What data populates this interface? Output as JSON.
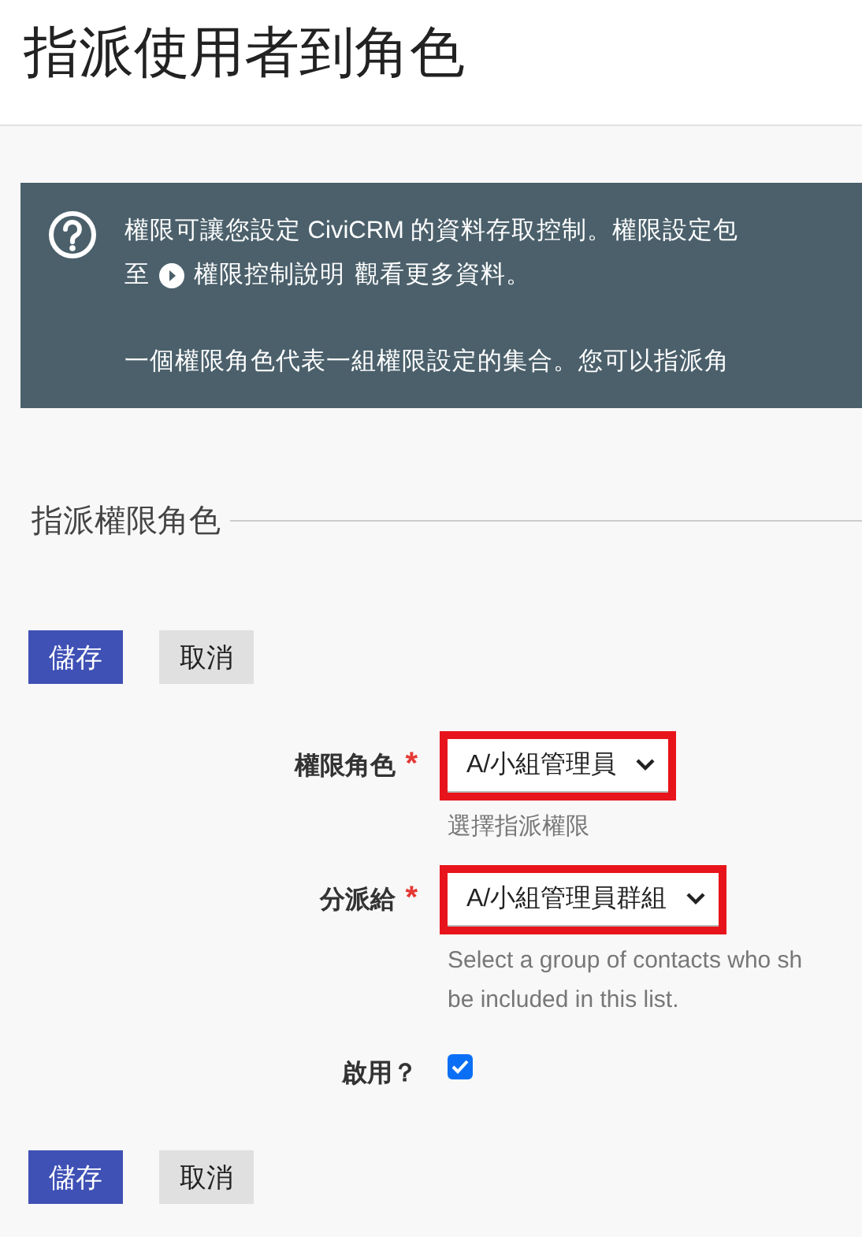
{
  "page_title": "指派使用者到角色",
  "help": {
    "line_1": "權限可讓您設定 CiviCRM 的資料存取控制。權限設定包",
    "line_2_before": "至",
    "link": "權限控制說明",
    "line_2_after": "觀看更多資料。",
    "line_3": "一個權限角色代表一組權限設定的集合。您可以指派角"
  },
  "fieldset": {
    "legend": "指派權限角色"
  },
  "top_buttons": [
    {
      "label": "儲存",
      "kind": "primary"
    },
    {
      "label": "取消",
      "kind": "secondary"
    }
  ],
  "fields": [
    {
      "kind": "select",
      "label": "權限角色",
      "required_mark": "*",
      "value": "A/小組管理員",
      "highlighted": true,
      "help_lines": [
        "選擇指派權限"
      ]
    },
    {
      "kind": "select",
      "label": "分派給",
      "required_mark": "*",
      "value": "A/小組管理員群組",
      "highlighted": true,
      "help_lines": [
        "Select a group of contacts who sh",
        "be included in this list."
      ]
    },
    {
      "kind": "checkbox",
      "label": "啟用？",
      "checked": true
    }
  ],
  "bottom_buttons": [
    {
      "label": "儲存",
      "kind": "primary"
    },
    {
      "label": "取消",
      "kind": "secondary"
    }
  ]
}
